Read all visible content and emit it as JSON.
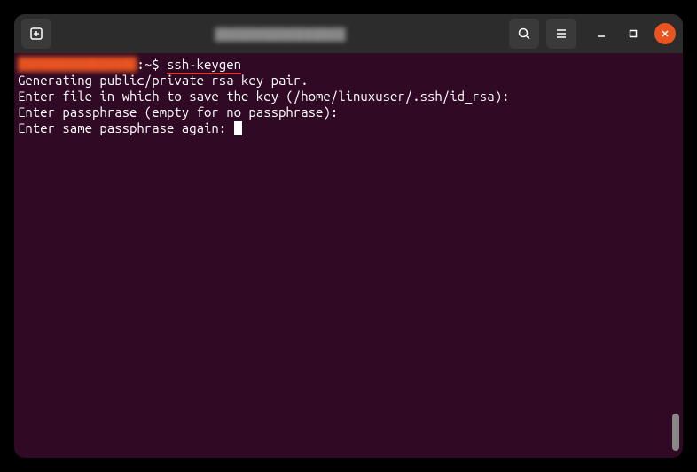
{
  "titlebar": {
    "title_blur": "████████████████"
  },
  "terminal": {
    "prompt_user_blur": "████████████████",
    "prompt_sep": ":",
    "prompt_path": "~",
    "prompt_dollar": "$ ",
    "command": "ssh-keygen",
    "lines": {
      "l1": "Generating public/private rsa key pair.",
      "l2": "Enter file in which to save the key (/home/linuxuser/.ssh/id_rsa): ",
      "l3": "Enter passphrase (empty for no passphrase): ",
      "l4": "Enter same passphrase again: "
    }
  }
}
